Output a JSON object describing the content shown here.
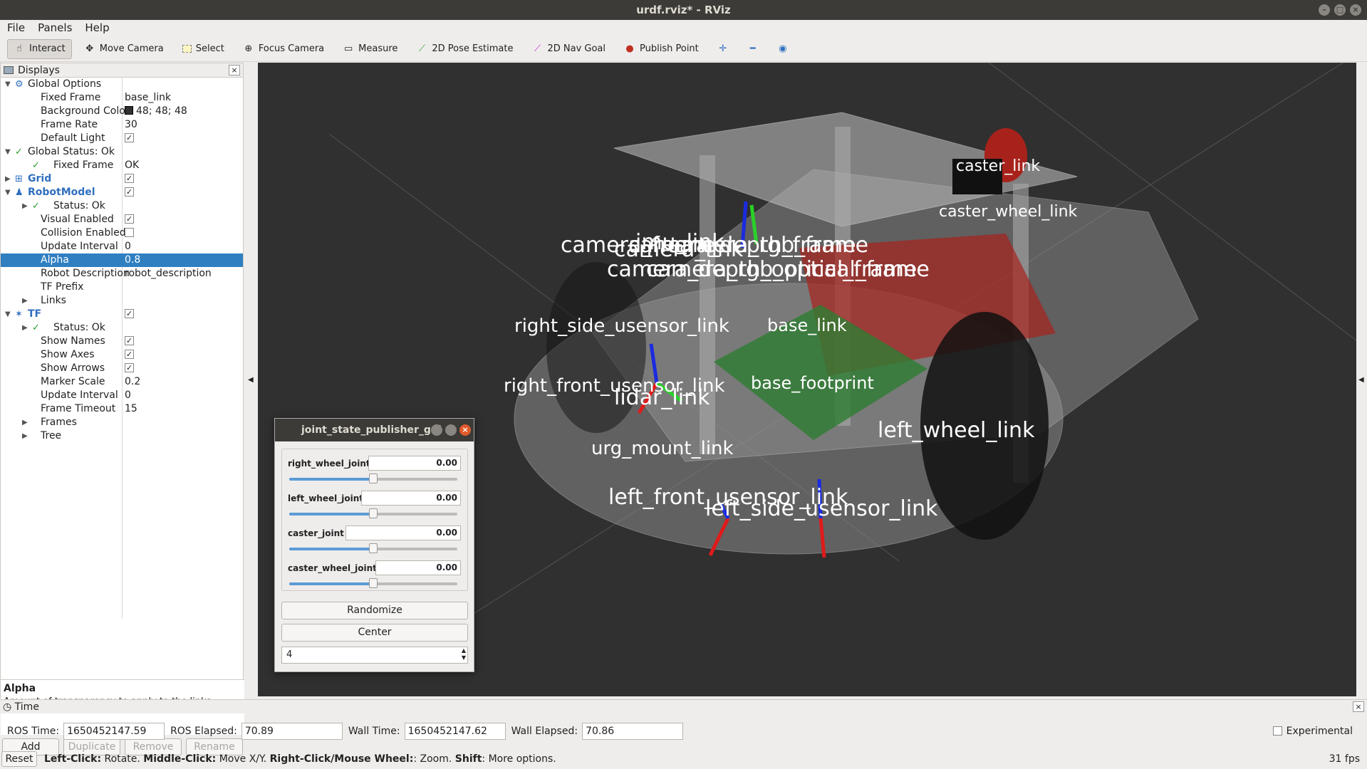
{
  "window": {
    "title": "urdf.rviz* - RViz"
  },
  "menu": [
    "File",
    "Panels",
    "Help"
  ],
  "toolbar": {
    "tools": [
      "Interact",
      "Move Camera",
      "Select",
      "Focus Camera",
      "Measure",
      "2D Pose Estimate",
      "2D Nav Goal",
      "Publish Point"
    ]
  },
  "displays": {
    "title": "Displays",
    "rows": [
      {
        "label": "Global Options",
        "value": ""
      },
      {
        "label": "Fixed Frame",
        "value": "base_link"
      },
      {
        "label": "Background Color",
        "value": "48; 48; 48"
      },
      {
        "label": "Frame Rate",
        "value": "30"
      },
      {
        "label": "Default Light",
        "value": "✓"
      },
      {
        "label": "Global Status: Ok",
        "value": ""
      },
      {
        "label": "Fixed Frame",
        "value": "OK"
      },
      {
        "label": "Grid",
        "value": "✓"
      },
      {
        "label": "RobotModel",
        "value": "✓"
      },
      {
        "label": "Status: Ok",
        "value": ""
      },
      {
        "label": "Visual Enabled",
        "value": "✓"
      },
      {
        "label": "Collision Enabled",
        "value": ""
      },
      {
        "label": "Update Interval",
        "value": "0"
      },
      {
        "label": "Alpha",
        "value": "0.8"
      },
      {
        "label": "Robot Description",
        "value": "robot_description"
      },
      {
        "label": "TF Prefix",
        "value": ""
      },
      {
        "label": "Links",
        "value": ""
      },
      {
        "label": "TF",
        "value": "✓"
      },
      {
        "label": "Status: Ok",
        "value": ""
      },
      {
        "label": "Show Names",
        "value": "✓"
      },
      {
        "label": "Show Axes",
        "value": "✓"
      },
      {
        "label": "Show Arrows",
        "value": "✓"
      },
      {
        "label": "Marker Scale",
        "value": "0.2"
      },
      {
        "label": "Update Interval",
        "value": "0"
      },
      {
        "label": "Frame Timeout",
        "value": "15"
      },
      {
        "label": "Frames",
        "value": ""
      },
      {
        "label": "Tree",
        "value": ""
      }
    ],
    "help_title": "Alpha",
    "help_text": "Amount of transparency to apply to the links.",
    "buttons": {
      "add": "Add",
      "duplicate": "Duplicate",
      "remove": "Remove",
      "rename": "Rename"
    }
  },
  "viewport": {
    "labels": [
      "imu_link",
      "caster_link",
      "caster_wheel_link",
      "camera_frame",
      "camera_depth_frame",
      "camera_rgb_frame",
      "camera_link",
      "camera_depth_optical_frame",
      "camera_rgb_optical_frame",
      "right_side_usensor_link",
      "base_link",
      "right_front_usensor_link",
      "base_footprint",
      "lidar_link",
      "left_wheel_link",
      "urg_mount_link",
      "left_front_usensor_link",
      "left_side_usensor_link"
    ]
  },
  "jsp": {
    "title": "joint_state_publisher_gui",
    "joints": [
      {
        "name": "right_wheel_joint",
        "value": "0.00"
      },
      {
        "name": "left_wheel_joint",
        "value": "0.00"
      },
      {
        "name": "caster_joint",
        "value": "0.00"
      },
      {
        "name": "caster_wheel_joint",
        "value": "0.00"
      }
    ],
    "randomize": "Randomize",
    "center": "Center",
    "spin": "4"
  },
  "time": {
    "title": "Time",
    "ros_time_label": "ROS Time:",
    "ros_time": "1650452147.59",
    "ros_elapsed_label": "ROS Elapsed:",
    "ros_elapsed": "70.89",
    "wall_time_label": "Wall Time:",
    "wall_time": "1650452147.62",
    "wall_elapsed_label": "Wall Elapsed:",
    "wall_elapsed": "70.86",
    "experimental": "Experimental"
  },
  "status": {
    "reset": "Reset",
    "left": "Left-Click:",
    "left_t": "Rotate.",
    "middle": "Middle-Click:",
    "middle_t": "Move X/Y.",
    "right": "Right-Click/Mouse Wheel:",
    "right_t": ": Zoom.",
    "shift": "Shift",
    "shift_t": ": More options.",
    "fps": "31 fps"
  }
}
